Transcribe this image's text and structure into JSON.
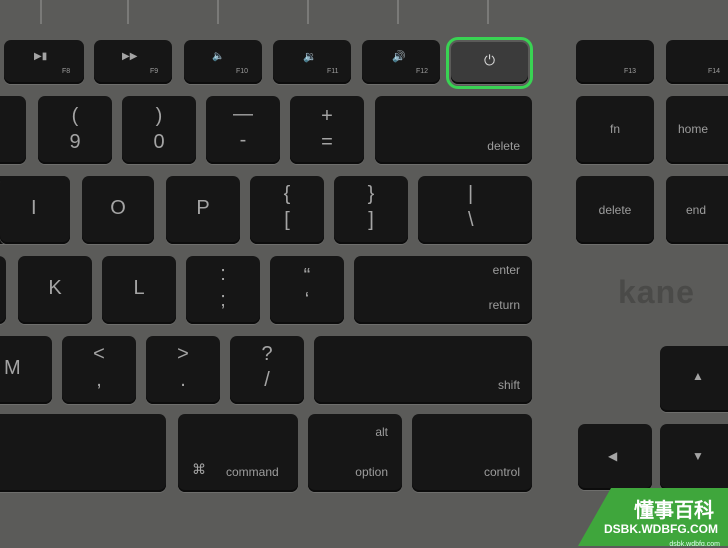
{
  "fn_row": {
    "f8": "F8",
    "f9": "F9",
    "f10": "F10",
    "f11": "F11",
    "f12": "F12",
    "power_glyph": "⏻",
    "f13": "F13",
    "f14": "F14",
    "play_pause_glyph": "▶▮",
    "fast_forward_glyph": "▶▶",
    "vol_down_glyph": "🔈",
    "vol_mid_glyph": "🔉",
    "vol_up_glyph": "🔊"
  },
  "number_row": {
    "nine_shift": "(",
    "nine": "9",
    "zero_shift": ")",
    "zero": "0",
    "minus_shift": "—",
    "minus": "-",
    "equals_shift": "+",
    "equals": "=",
    "delete": "delete",
    "fn": "fn",
    "home": "home"
  },
  "top_row": {
    "i": "I",
    "o": "O",
    "p": "P",
    "lbrace": "{",
    "lbracket": "[",
    "rbrace": "}",
    "rbracket": "]",
    "pipe": "|",
    "backslash": "\\",
    "delete_fwd": "delete",
    "end": "end"
  },
  "home_row": {
    "k": "K",
    "l": "L",
    "colon": ":",
    "semicolon": ";",
    "quote": "“",
    "apostrophe": "‘",
    "enter": "enter",
    "return": "return"
  },
  "bottom_row": {
    "m": "M",
    "lt": "<",
    "comma": ",",
    "gt": ">",
    "period": ".",
    "question": "?",
    "slash": "/",
    "shift": "shift"
  },
  "space_row": {
    "cmd_glyph": "⌘",
    "command": "command",
    "alt": "alt",
    "option": "option",
    "control": "control",
    "up_glyph": "▲",
    "left_glyph": "◀",
    "down_glyph": "▼"
  },
  "brand": "kane",
  "watermark": {
    "title": "懂事百科",
    "domain": "DSBK.WDBFG.COM",
    "small": "dsbk.wdbfg.com"
  },
  "colors": {
    "key": "#161616",
    "highlight_outline": "#39d353",
    "body": "#5b5b59",
    "watermark_bg": "#3fa63c"
  }
}
